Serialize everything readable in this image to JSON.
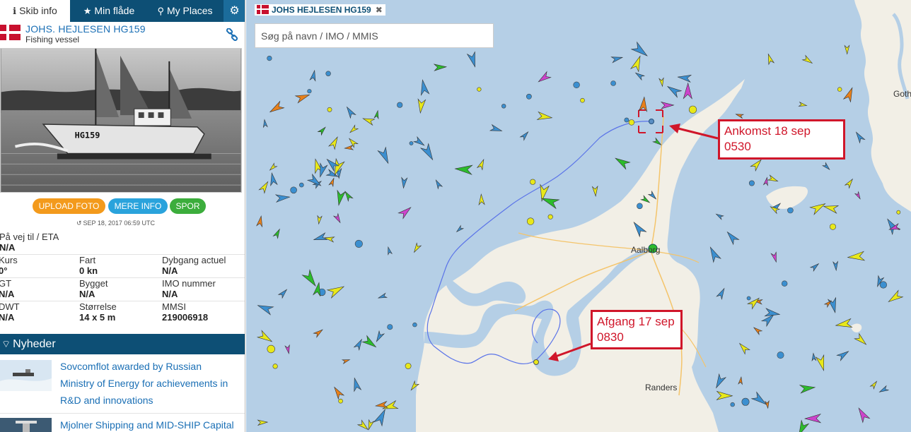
{
  "tabs": {
    "skib_info": "Skib info",
    "min_flade": "Min flåde",
    "my_places": "My Places",
    "gear": "gear-icon"
  },
  "vessel": {
    "name": "JOHS. HEJLESEN HG159",
    "type": "Fishing vessel",
    "flag": "DK"
  },
  "buttons": {
    "upload": "UPLOAD FOTO",
    "more_info": "MERE INFO",
    "track": "SPOR"
  },
  "timestamp": "SEP 18, 2017 06:59 UTC",
  "details": {
    "destination_label": "På vej til / ETA",
    "destination_value": "N/A",
    "rows": [
      [
        {
          "label": "Kurs",
          "value": "0°"
        },
        {
          "label": "Fart",
          "value": "0 kn"
        },
        {
          "label": "Dybgang actuel",
          "value": "N/A"
        }
      ],
      [
        {
          "label": "GT",
          "value": "N/A"
        },
        {
          "label": "Bygget",
          "value": "N/A"
        },
        {
          "label": "IMO nummer",
          "value": "N/A"
        }
      ],
      [
        {
          "label": "DWT",
          "value": "N/A"
        },
        {
          "label": "Størrelse",
          "value": "14 x 5 m"
        },
        {
          "label": "MMSI",
          "value": "219006918"
        }
      ]
    ]
  },
  "news": {
    "header": "Nyheder",
    "items": [
      {
        "line1": "Sovcomflot awarded by Russian",
        "line2": "Ministry of Energy for achievements in",
        "line3": "R&D and innovations"
      },
      {
        "line1": "Mjolner Shipping and MID-SHIP Capital"
      }
    ]
  },
  "map": {
    "title": "JOHS HEJLESEN HG159",
    "close": "✖",
    "search_placeholder": "Søg på navn / IMO / MMIS",
    "arrival": {
      "line1": "Ankomst 18 sep",
      "line2": "0530"
    },
    "departure": {
      "line1": "Afgang 17 sep",
      "line2": "0830"
    },
    "towns": {
      "aalborg": "Aalborg",
      "randers": "Randers",
      "gothenburg_partial": "Gothe"
    },
    "colors": {
      "water": "#b5cfe6",
      "land": "#f2efe6",
      "route": "#5b74e8",
      "callout": "#d0162a",
      "cargo": "#e8e81a",
      "tanker": "#e8801a",
      "passenger": "#3b8fd0",
      "fishing": "#2cbc2c",
      "other": "#cc44cc"
    }
  }
}
